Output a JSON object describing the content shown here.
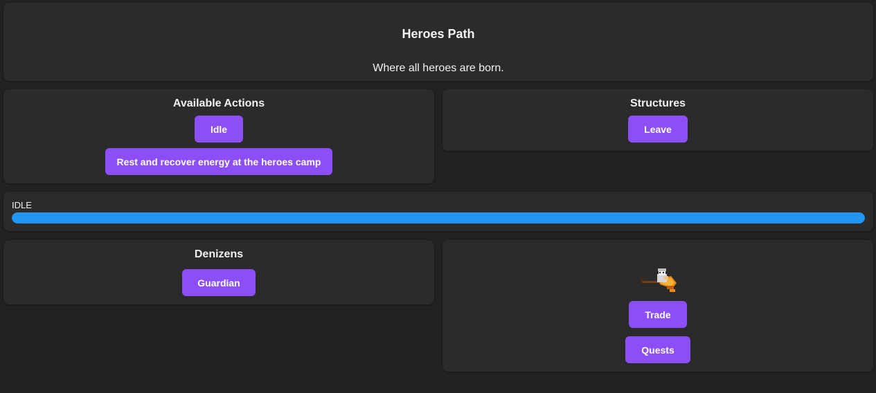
{
  "header": {
    "title": "Heroes Path",
    "subtitle": "Where all heroes are born."
  },
  "actions": {
    "title": "Available Actions",
    "buttons": [
      "Idle",
      "Rest and recover energy at the heroes camp"
    ]
  },
  "structures": {
    "title": "Structures",
    "buttons": [
      "Leave"
    ]
  },
  "status": {
    "label": "IDLE",
    "progress_percent": 100,
    "bar_color": "#2196f3"
  },
  "denizens": {
    "title": "Denizens",
    "buttons": [
      "Guardian"
    ]
  },
  "trader": {
    "sprite_icon": "flying-wizard-on-broom-icon",
    "buttons": [
      "Trade",
      "Quests"
    ]
  },
  "colors": {
    "background": "#222222",
    "panel": "#2b2b2b",
    "button": "#8c4ff5"
  }
}
